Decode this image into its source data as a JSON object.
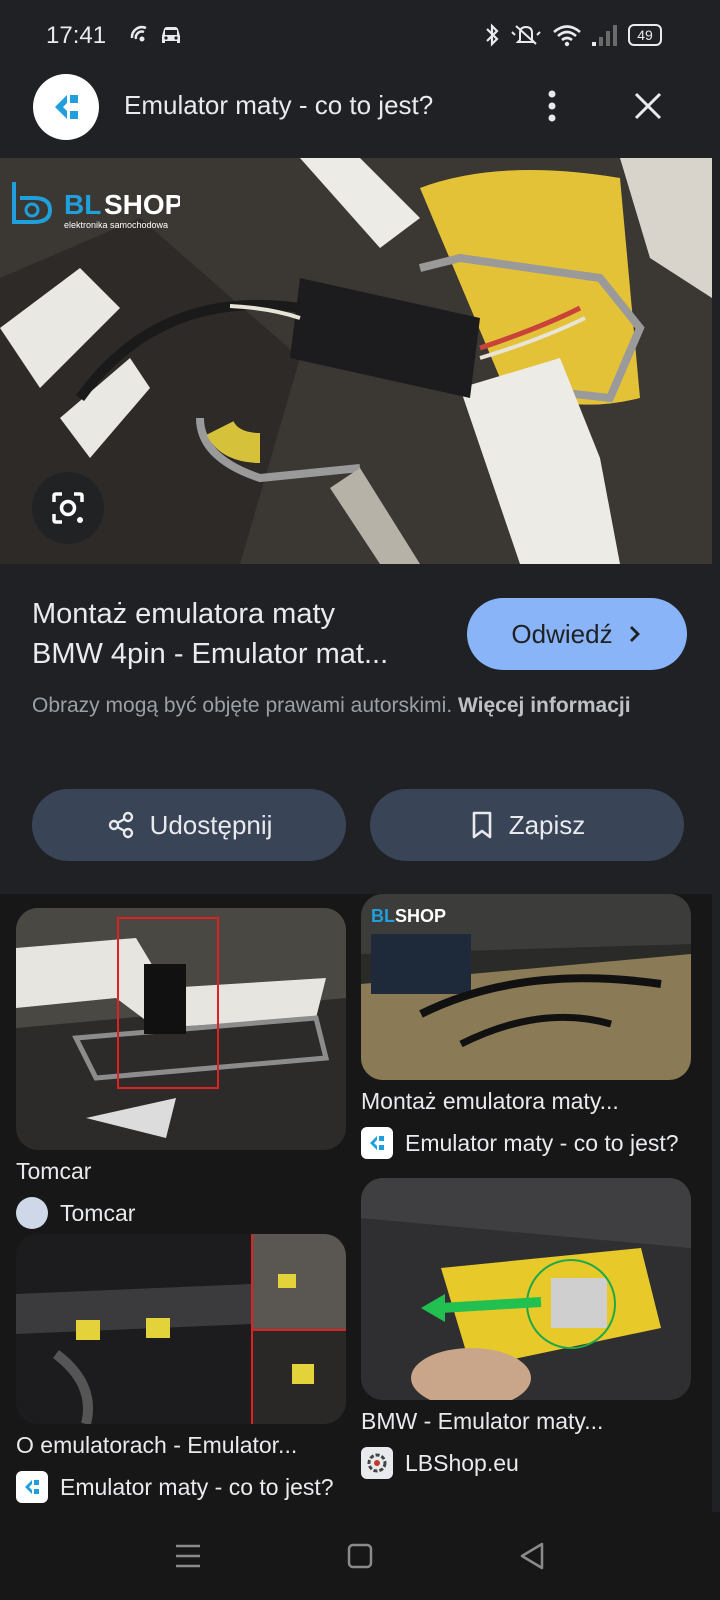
{
  "status_bar": {
    "time": "17:41",
    "battery": "49",
    "icons": [
      "hotspot-icon",
      "car-icon",
      "bluetooth-icon",
      "mute-icon",
      "wifi-icon",
      "signal-icon",
      "battery-icon"
    ]
  },
  "header": {
    "title": "Emulator maty - co to jest?",
    "menu_icon": "more-vert-icon",
    "close_icon": "close-icon"
  },
  "hero": {
    "brand_text": "BLSHOP",
    "brand_sub": "elektronika samochodowa",
    "lens_icon": "lens-icon"
  },
  "result": {
    "title_line1": "Montaż emulatora maty",
    "title_line2": "BMW 4pin - Emulator mat...",
    "visit_label": "Odwiedź",
    "copyright_text": "Obrazy mogą być objęte prawami autorskimi.",
    "more_info_label": "Więcej informacji",
    "share_label": "Udostępnij",
    "save_label": "Zapisz"
  },
  "related": [
    {
      "caption": "Tomcar",
      "source": "Tomcar"
    },
    {
      "caption": "Montaż emulatora maty...",
      "source": "Emulator maty - co to jest?"
    },
    {
      "caption": "O emulatorach - Emulator...",
      "source": "Emulator maty - co to jest?"
    },
    {
      "caption": "BMW - Emulator maty...",
      "source": "LBShop.eu"
    }
  ],
  "colors": {
    "background": "#202124",
    "accent": "#8ab4f8",
    "button_dark": "#394457"
  }
}
